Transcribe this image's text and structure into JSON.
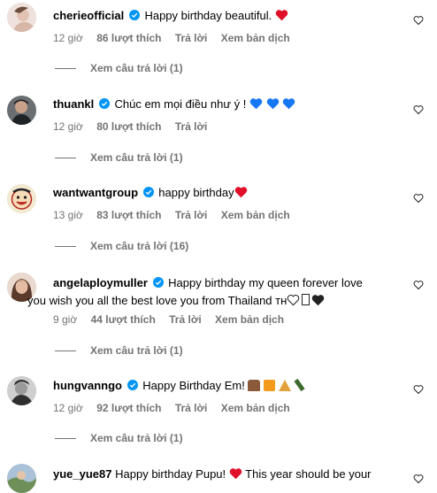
{
  "comments": [
    {
      "username": "cherieofficial",
      "text": "Happy birthday beautiful.",
      "text2": "",
      "emoji": "❤️",
      "time": "12 giờ",
      "likes": "86 lượt thích",
      "reply": "Trả lời",
      "translate": "Xem bản dịch",
      "view_replies": "Xem câu trả lời (1)",
      "avatar_color": "#e8d6cf"
    },
    {
      "username": "thuankl",
      "text": "Chúc em mọi điều như ý ! ",
      "text2": "",
      "emoji": "💙 💙 💙",
      "time": "12 giờ",
      "likes": "80 lượt thích",
      "reply": "Trả lời",
      "translate": "",
      "view_replies": "Xem câu trả lời (1)",
      "avatar_color": "#3a3d40"
    },
    {
      "username": "wantwantgroup",
      "text": "happy birthday",
      "text2": "",
      "emoji": "❤️",
      "time": "13 giờ",
      "likes": "83 lượt thích",
      "reply": "Trả lời",
      "translate": "Xem bản dịch",
      "view_replies": "Xem câu trả lời (16)",
      "avatar_color": "#f2e6c9"
    },
    {
      "username": "angelaploymuller",
      "text": "Happy birthday my queen forever love",
      "text2": "you wish you all the best love you from Thailand ᴛʜ",
      "emoji": "🤍▯🖤",
      "time": "9 giờ",
      "likes": "44 lượt thích",
      "reply": "Trả lời",
      "translate": "Xem bản dịch",
      "view_replies": "Xem câu trả lời (1)",
      "avatar_color": "#c9a48e"
    },
    {
      "username": "hungvanngo",
      "text": "Happy Birthday Em! ",
      "text2": "",
      "emoji": "🎂🎁🎉🍾",
      "time": "12 giờ",
      "likes": "92 lượt thích",
      "reply": "Trả lời",
      "translate": "Xem bản dịch",
      "view_replies": "Xem câu trả lời (1)",
      "avatar_color": "#555a5e"
    },
    {
      "username": "yue_yue87",
      "text": "Happy birthday Pupu! ",
      "text2": "",
      "emoji": "❤️",
      "text_after": "This year should be your",
      "avatar_color": "#8fa67a"
    }
  ],
  "icons": {
    "verified": "verified-badge-icon",
    "like": "heart-outline-icon"
  },
  "colors": {
    "meta": "#737373",
    "verified": "#0095f6",
    "heart_red": "#e0102a",
    "heart_blue": "#1877f2"
  }
}
